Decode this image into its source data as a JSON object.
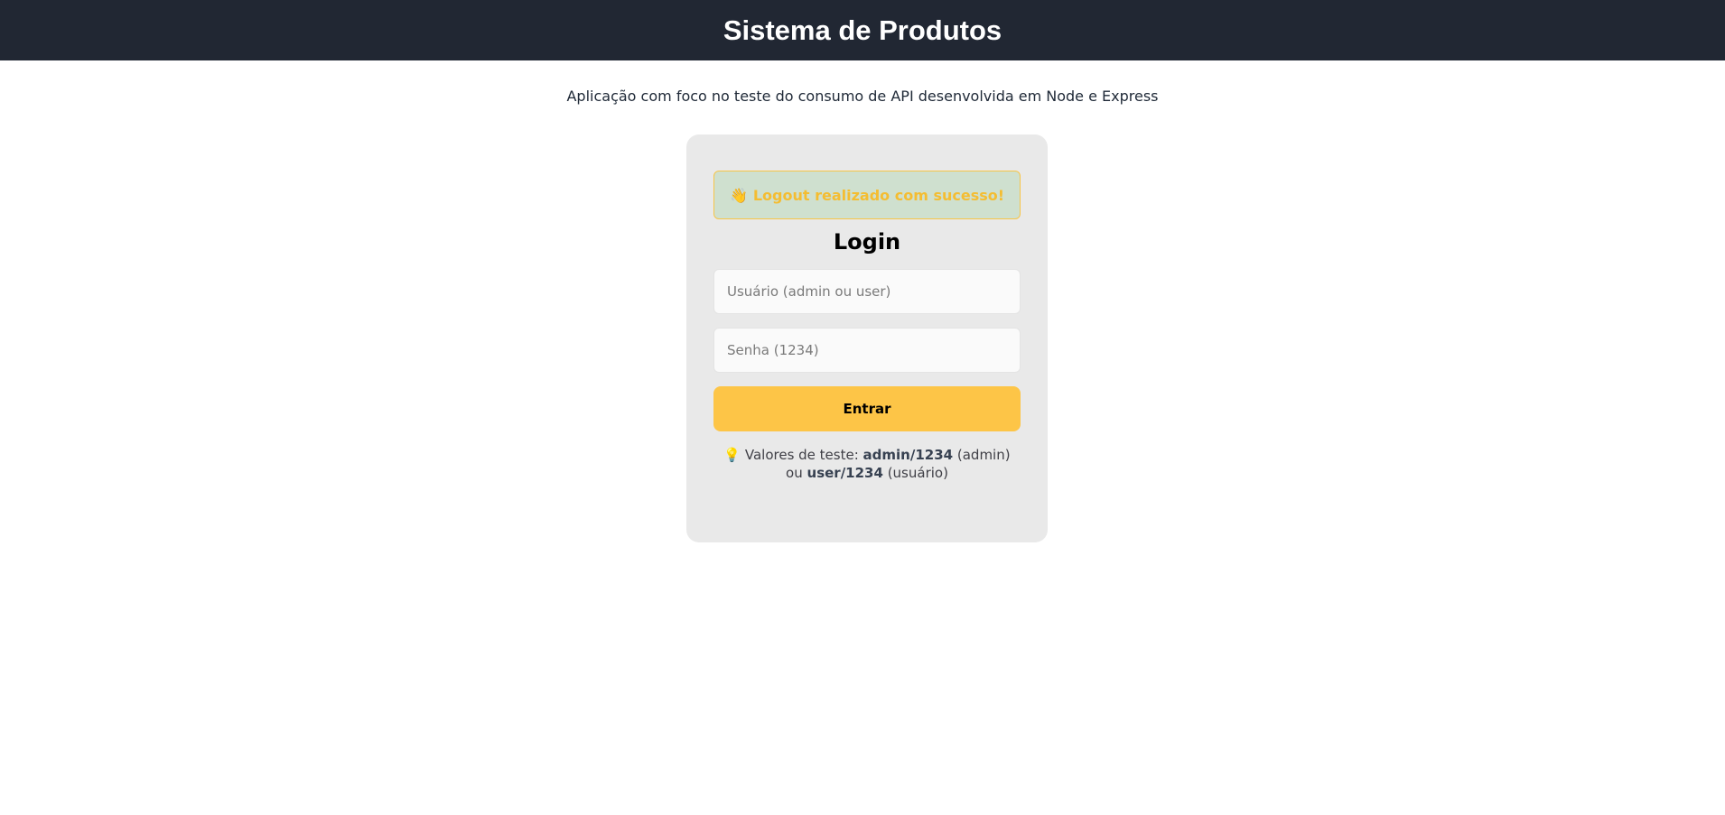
{
  "header": {
    "title": "Sistema de Produtos"
  },
  "subtitle": "Aplicação com foco no teste do consumo de API desenvolvida em Node e Express",
  "alert": {
    "icon": "👋",
    "icon_name": "waving-hand-icon",
    "text": "Logout realizado com sucesso!"
  },
  "login": {
    "title": "Login",
    "username_placeholder": "Usuário (admin ou user)",
    "username_value": "",
    "password_placeholder": "Senha (1234)",
    "password_value": "",
    "submit_label": "Entrar"
  },
  "hint": {
    "icon": "💡",
    "icon_name": "light-bulb-icon",
    "prefix": "Valores de teste:",
    "admin_cred": "admin/1234",
    "admin_role": "(admin)",
    "or": "ou",
    "user_cred": "user/1234",
    "user_role": "(usuário)"
  },
  "colors": {
    "header_bg": "#212733",
    "accent": "#fdc547",
    "alert_bg": "#cfe0cf",
    "alert_text": "#f4bd32",
    "card_bg": "#e9e9e9"
  }
}
